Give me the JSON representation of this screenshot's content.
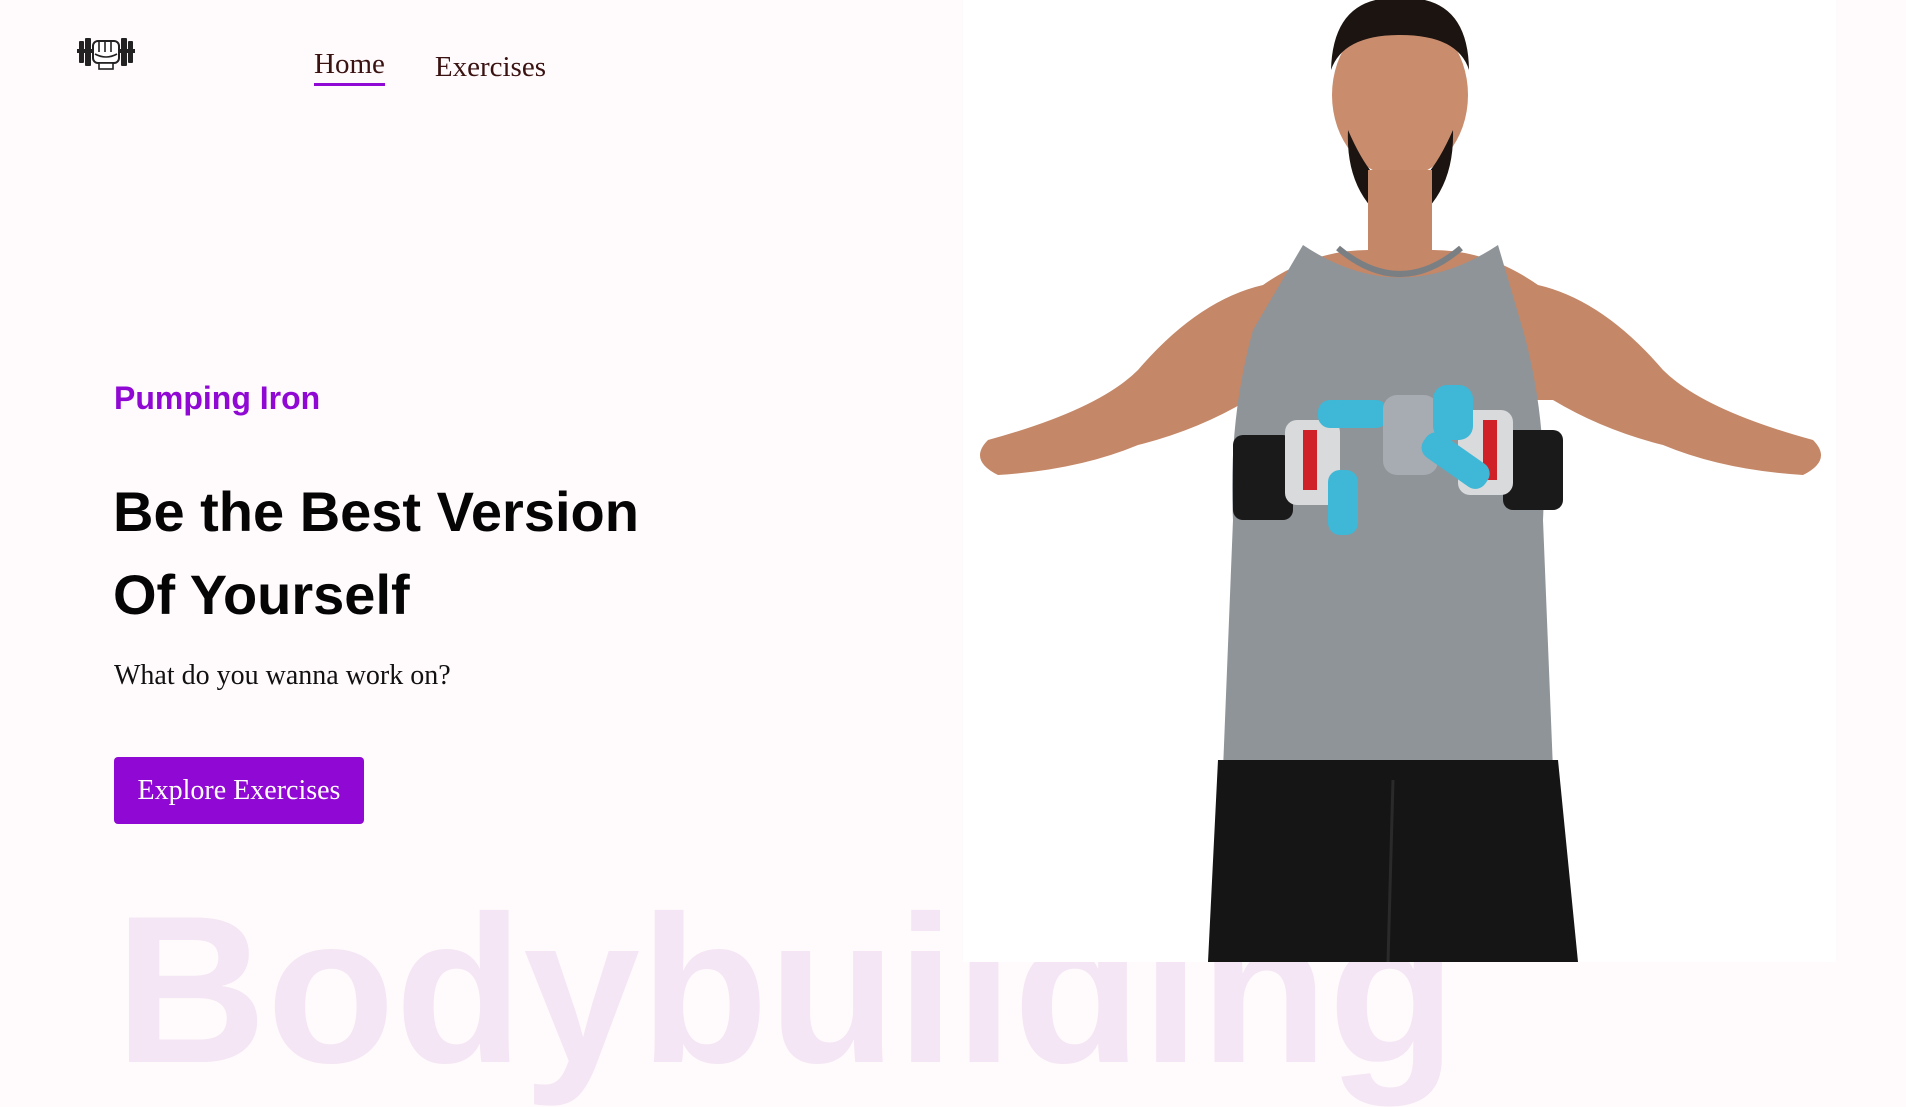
{
  "nav": {
    "logo_icon": "dumbbell-fist-icon",
    "home_label": "Home",
    "exercises_label": "Exercises",
    "active": "Home"
  },
  "hero": {
    "kicker": "Pumping Iron",
    "headline_line1": "Be the Best Version",
    "headline_line2": "Of Yourself",
    "subtitle": "What do you wanna work on?",
    "cta_label": "Explore Exercises",
    "watermark": "Bodybuilding",
    "image_description_icon": "man-with-hand-grippers-image"
  },
  "colors": {
    "accent": "#9008d3",
    "background": "#fffafb",
    "watermark": "#f4e6f4",
    "nav_text": "#3a1212"
  }
}
